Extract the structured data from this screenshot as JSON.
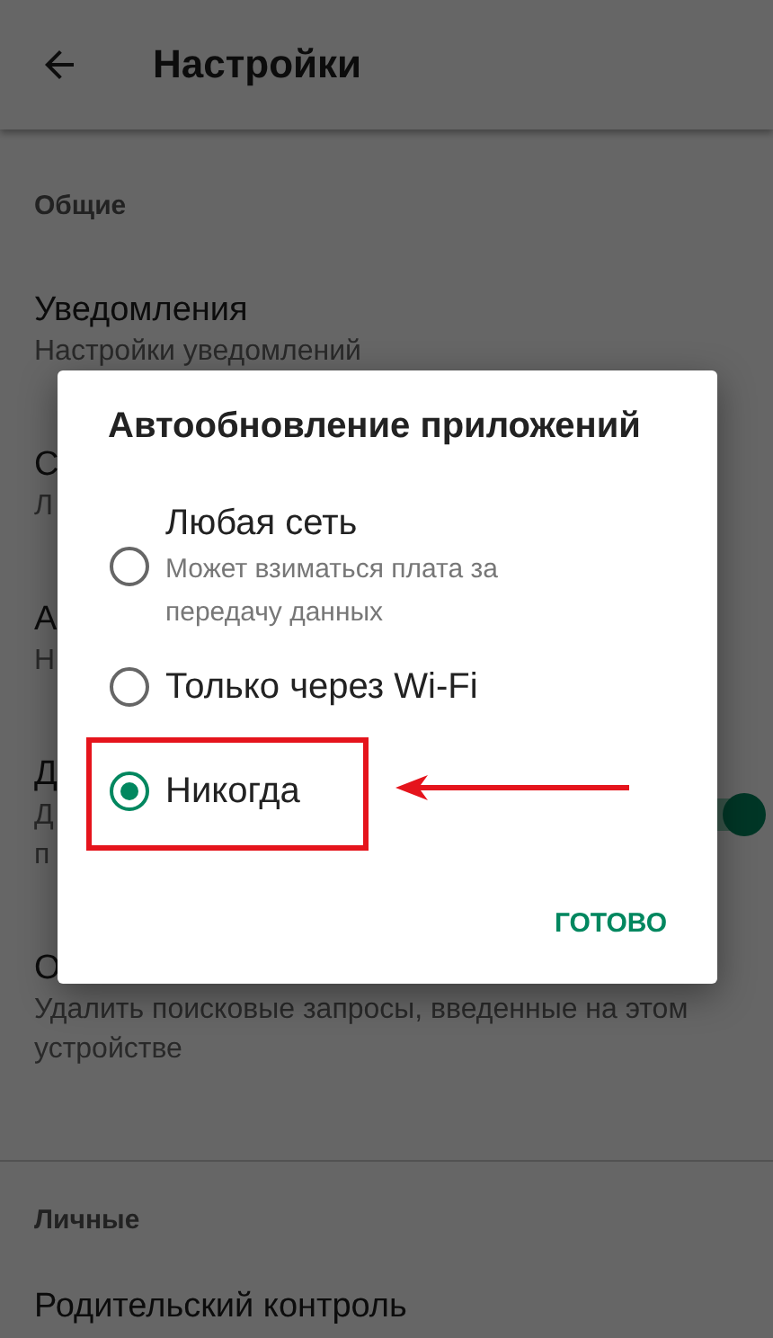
{
  "app_bar": {
    "title": "Настройки"
  },
  "sections": [
    {
      "header": "Общие",
      "items": [
        {
          "title": "Уведомления",
          "subtitle": [
            "Настройки уведомлений"
          ]
        },
        {
          "title": "С",
          "subtitle": [
            "Л"
          ]
        },
        {
          "title": "А",
          "subtitle": [
            "Н"
          ]
        },
        {
          "title": "Д",
          "subtitle": [
            "Д",
            "п"
          ],
          "toggle": {
            "on": true
          }
        },
        {
          "title": "О",
          "subtitle": [
            "Удалить поисковые запросы, введенные на этом устройстве"
          ]
        }
      ]
    },
    {
      "header": "Личные",
      "items": [
        {
          "title": "Родительский контроль"
        }
      ]
    }
  ],
  "dialog": {
    "title": "Автообновление приложений",
    "options": [
      {
        "label": "Любая сеть",
        "description": "Может взиматься плата за передачу данных",
        "selected": false
      },
      {
        "label": "Только через Wi-Fi",
        "selected": false
      },
      {
        "label": "Никогда",
        "selected": true
      }
    ],
    "button": "ГОТОВО"
  }
}
